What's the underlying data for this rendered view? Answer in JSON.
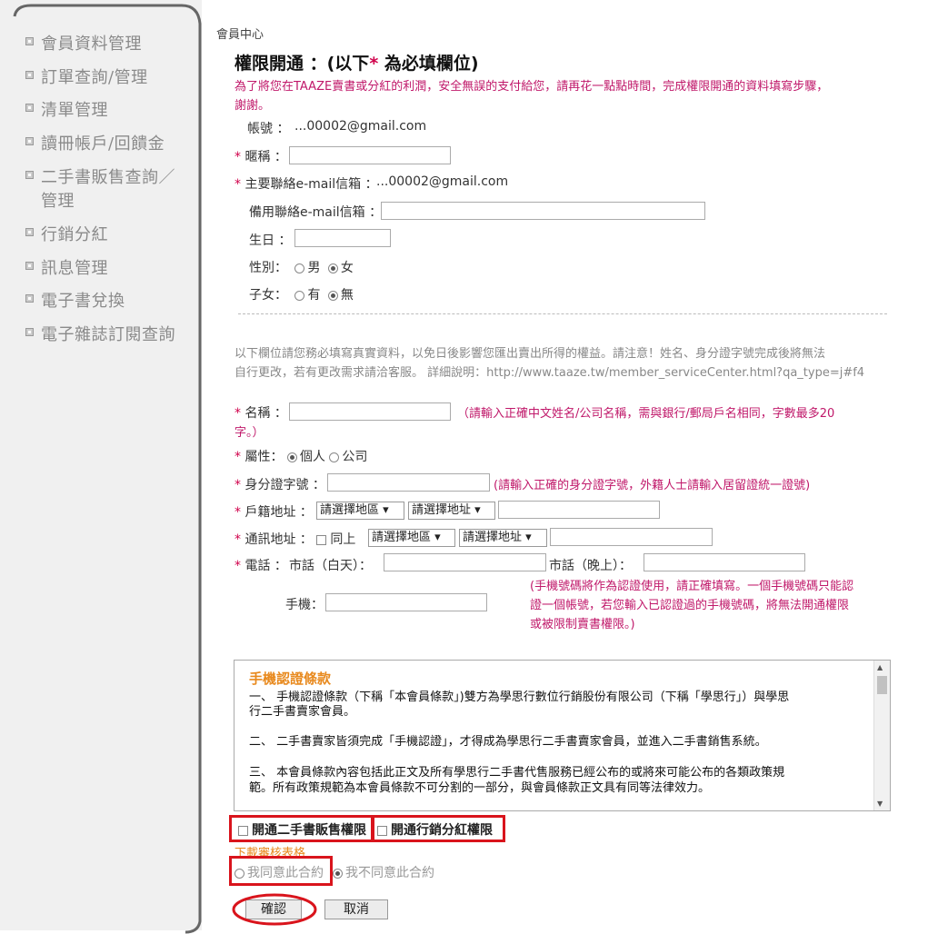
{
  "sidebar": {
    "items": [
      {
        "label": "會員資料管理"
      },
      {
        "label": "訂單查詢/管理"
      },
      {
        "label": "清單管理"
      },
      {
        "label": "讀冊帳戶/回饋金"
      },
      {
        "label": "二手書販售查詢／"
      },
      {
        "label": "管理"
      },
      {
        "label": "行銷分紅"
      },
      {
        "label": "訊息管理"
      },
      {
        "label": "電子書兌換"
      },
      {
        "label": "電子雜誌訂閱查詢"
      }
    ]
  },
  "breadcrumb": "會員中心",
  "heading": {
    "prefix": "權限開通 ：(以下",
    "star": "*",
    "suffix": " 為必填欄位)"
  },
  "intro": {
    "line1": "為了將您在TAAZE賣書或分紅的利潤，安全無誤的支付給您，請再花一點點時間，完成權限開通的資料填寫步驟，",
    "line2": "謝謝。"
  },
  "form1": {
    "account_label": "帳號 ：",
    "account_value": "...00002@gmail.com",
    "nickname_label": "暱稱 ：",
    "email_label": "主要聯絡e-mail信箱 ：",
    "email_value": "...00002@gmail.com",
    "backup_email_label": "備用聯絡e-mail信箱 ：",
    "birthday_label": "生日 ：",
    "gender_label": "性別：",
    "gender_male": "男",
    "gender_female": "女",
    "children_label": "子女：",
    "children_yes": "有",
    "children_no": "無"
  },
  "notice": {
    "line1": "以下欄位請您務必填寫真實資料，以免日後影響您匯出賣出所得的權益。請注意！姓名、身分證字號完成後將無法",
    "line2": "自行更改，若有更改需求請洽客服。 詳細說明：http://www.taaze.tw/member_serviceCenter.html?qa_type=j#f4"
  },
  "form2": {
    "name_label": "名稱 ：",
    "name_hint1": "（請輸入正確中文姓名/公司名稱，需與銀行/郵局戶名相同，字數最多20",
    "name_hint2": "字。）",
    "type_label": "屬性：",
    "type_personal": "個人",
    "type_company": "公司",
    "id_label": "身分證字號 ：",
    "id_hint": "(請輸入正確的身分證字號，外籍人士請輸入居留證統一證號)",
    "household_label": "戶籍地址 ：",
    "select_region": "請選擇地區",
    "select_address": "請選擇地址",
    "mailing_label": "通訊地址 ：",
    "same_label": "同上",
    "phone_label": "電話 ：",
    "day_phone_label": "市話（白天）：",
    "night_phone_label": "市話（晚上）：",
    "phone_hint1": "(手機號碼將作為認證使用，請正確填寫。一個手機號碼只能認",
    "phone_hint2": "證一個帳號，若您輸入已認證過的手機號碼，將無法開通權限",
    "phone_hint3": "或被限制賣書權限。)",
    "mobile_label": "手機："
  },
  "terms": {
    "title": "手機認證條款",
    "p1a": "一、 手機認證條款（下稱「本會員條款」)雙方為學思行數位行銷股份有限公司（下稱「學思行」）與學思",
    "p1b": "行二手書賣家會員。",
    "p2": "二、 二手書賣家皆須完成「手機認證」，才得成為學思行二手書賣家會員，並進入二手書銷售系統。",
    "p3a": "三、 本會員條款內容包括此正文及所有學思行二手書代售服務已經公布的或將來可能公布的各類政策規",
    "p3b": "範。所有政策規範為本會員條款不可分割的一部分，與會員條款正文具有同等法律效力。"
  },
  "permissions": {
    "used_book_label": "開通二手書販售權限",
    "marketing_label": "開通行銷分紅權限"
  },
  "download_link": "下載審核表格",
  "agreement": {
    "agree": "我同意此合約",
    "disagree": "我不同意此合約"
  },
  "buttons": {
    "confirm": "確認",
    "cancel": "取消"
  },
  "colors": {
    "required": "#d0004b",
    "hint": "#c0186a",
    "accent_orange": "#e8891d",
    "highlight_red": "#d9141c"
  }
}
